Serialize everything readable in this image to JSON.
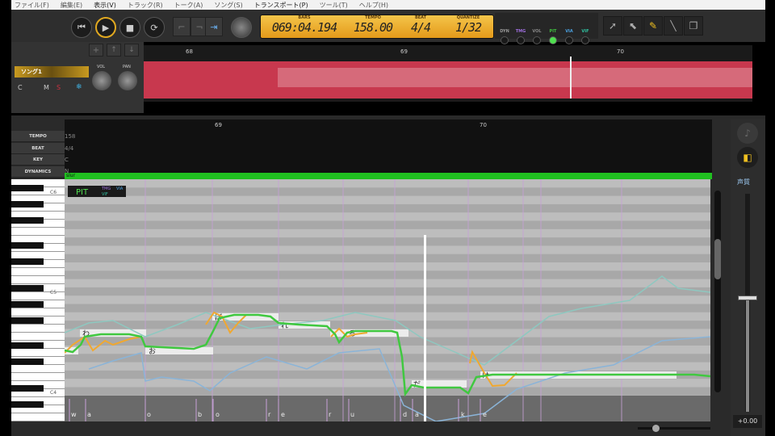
{
  "menu": [
    "ファイル(F)",
    "編集(E)",
    "表示(V)",
    "トラック(R)",
    "トーク(A)",
    "ソング(S)",
    "トランスポート(P)",
    "ツール(T)",
    "ヘルプ(H)"
  ],
  "transport": {
    "rewind": "⏮",
    "play": "▶",
    "stop": "■",
    "loop": "⟳"
  },
  "lcd": {
    "bars_label": "BARS",
    "bars": "069:04.194",
    "tempo_label": "TEMPO",
    "tempo": "158.00",
    "beat_label": "BEAT",
    "beat": "4/4",
    "quantize_label": "QUANTIZE",
    "quantize": "1/32"
  },
  "modes": [
    {
      "label": "DYN",
      "color": "#999",
      "on": false
    },
    {
      "label": "TMG",
      "color": "#a070e0",
      "on": false
    },
    {
      "label": "VOL",
      "color": "#888",
      "on": false
    },
    {
      "label": "PIT",
      "color": "#40c040",
      "on": true
    },
    {
      "label": "VIA",
      "color": "#4aa0e0",
      "on": false
    },
    {
      "label": "VIF",
      "color": "#30c0a0",
      "on": false
    }
  ],
  "track": {
    "name": "ソング1",
    "vol_label": "VOL",
    "pan_label": "PAN",
    "c": "C",
    "m": "M",
    "s": "S"
  },
  "ruler": {
    "top": [
      "68",
      "69",
      "70"
    ],
    "editor": [
      "69",
      "70"
    ]
  },
  "headers": {
    "tempo": "TEMPO",
    "beat": "BEAT",
    "key": "KEY",
    "dynamics": "DYNAMICS"
  },
  "header_values": {
    "tempo": "158",
    "beat": "4/4",
    "key": "C",
    "dynamics": "N"
  },
  "slur": "slur",
  "param_badges": {
    "main": "PIT",
    "tmg": "TMG",
    "via": "VIA",
    "vif": "VIF"
  },
  "piano_labels": {
    "c6": "C6",
    "c5": "C5",
    "c4": "C4"
  },
  "notes": [
    "わ",
    "お",
    "ぼ",
    "れ",
    "る",
    "だ",
    "け"
  ],
  "phonemes": [
    "w",
    "a",
    "o",
    "b",
    "o",
    "r",
    "e",
    "r",
    "u",
    "d",
    "a",
    "k",
    "e"
  ],
  "right_panel": {
    "label": "声質",
    "value": "+0.00"
  }
}
